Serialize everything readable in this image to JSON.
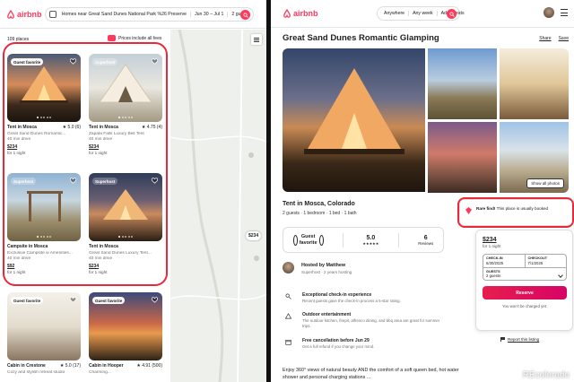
{
  "left": {
    "brand": "airbnb",
    "search": {
      "location": "Homes near Great Sand Dunes National Park %26 Preserve",
      "dates": "Jun 30 – Jul 1",
      "guests": "2 guests"
    },
    "places_count": "109 places",
    "prices_toggle": "Prices include all fees",
    "map_pin": "$234",
    "cards": [
      {
        "badge": "Guest favorite",
        "title": "Tent in Mosca",
        "rating": "★ 5.0 (6)",
        "name": "Great Sand Dunes Romantic...",
        "drive": "40 min drive",
        "price": "$234",
        "per": "for 1 night"
      },
      {
        "badge": "Superhost",
        "title": "Tent in Mosca",
        "rating": "★ 4.75 (4)",
        "name": "Zapata Falls Luxury Bell Tent",
        "drive": "40 min drive",
        "price": "$234",
        "per": "for 1 night"
      },
      {
        "badge": "Superhost",
        "title": "Campsite in Mosca",
        "rating": "",
        "name": "Exclusive Campsite w Amenities...",
        "drive": "40 min drive",
        "price": "$92",
        "per": "for 1 night"
      },
      {
        "badge": "Superhost",
        "title": "Tent in Mosca",
        "rating": "",
        "name": "Great Sand Dunes Luxury Tent...",
        "drive": "40 min drive",
        "price": "$234",
        "per": "for 1 night"
      },
      {
        "badge": "Guest favorite",
        "title": "Cabin in Crestone",
        "rating": "★ 5.0 (17)",
        "name": "Cozy and stylish retreat studio",
        "drive": "",
        "price": "",
        "per": ""
      },
      {
        "badge": "Guest favorite",
        "title": "Cabin in Hooper",
        "rating": "★ 4.91 (500)",
        "name": "Charming...",
        "drive": "",
        "price": "",
        "per": ""
      }
    ]
  },
  "right": {
    "brand": "airbnb",
    "search": {
      "where": "Anywhere",
      "when": "Any week",
      "who": "Add guests"
    },
    "title": "Great Sand Dunes Romantic Glamping",
    "share": "Share",
    "save": "Save",
    "show_all_photos": "Show all photos",
    "location_title": "Tent in Mosca, Colorado",
    "location_sub": "2 guests · 1 bedroom · 1 bed · 1 bath",
    "rare": {
      "bold": "Rare find!",
      "text": " This place is usually booked"
    },
    "favorite": {
      "label_1": "Guest",
      "label_2": "favorite",
      "rating": "5.0",
      "stars": "★★★★★",
      "reviews_count": "6",
      "reviews_label": "Reviews"
    },
    "host": {
      "name": "Hosted by Matthew",
      "sub": "Superhost · 2 years hosting"
    },
    "features": [
      {
        "icon": "door-icon",
        "title": "Exceptional check-in experience",
        "desc": "Recent guests gave the check-in process a 5-star rating."
      },
      {
        "icon": "tent-icon",
        "title": "Outdoor entertainment",
        "desc": "The outdoor kitchen, firepit, alfresco dining, and bbq area are great for summer trips."
      },
      {
        "icon": "calendar-icon",
        "title": "Free cancellation before Jun 29",
        "desc": "Get a full refund if you change your mind."
      }
    ],
    "description": "Enjoy 360° views of natural beauty AND the comfort of a soft queen bed, hot water shower and personal charging stations ...",
    "booking": {
      "price": "$234",
      "per": "for 1 night",
      "checkin_label": "CHECK-IN",
      "checkin": "6/30/2025",
      "checkout_label": "CHECKOUT",
      "checkout": "7/1/2025",
      "guests_label": "GUESTS",
      "guests": "2 guests",
      "reserve": "Reserve",
      "note": "You won't be charged yet"
    },
    "report": "Report this listing"
  },
  "watermark": "REcolorado",
  "colors": {
    "brand": "#ff385c",
    "highlight": "#e8293b"
  }
}
